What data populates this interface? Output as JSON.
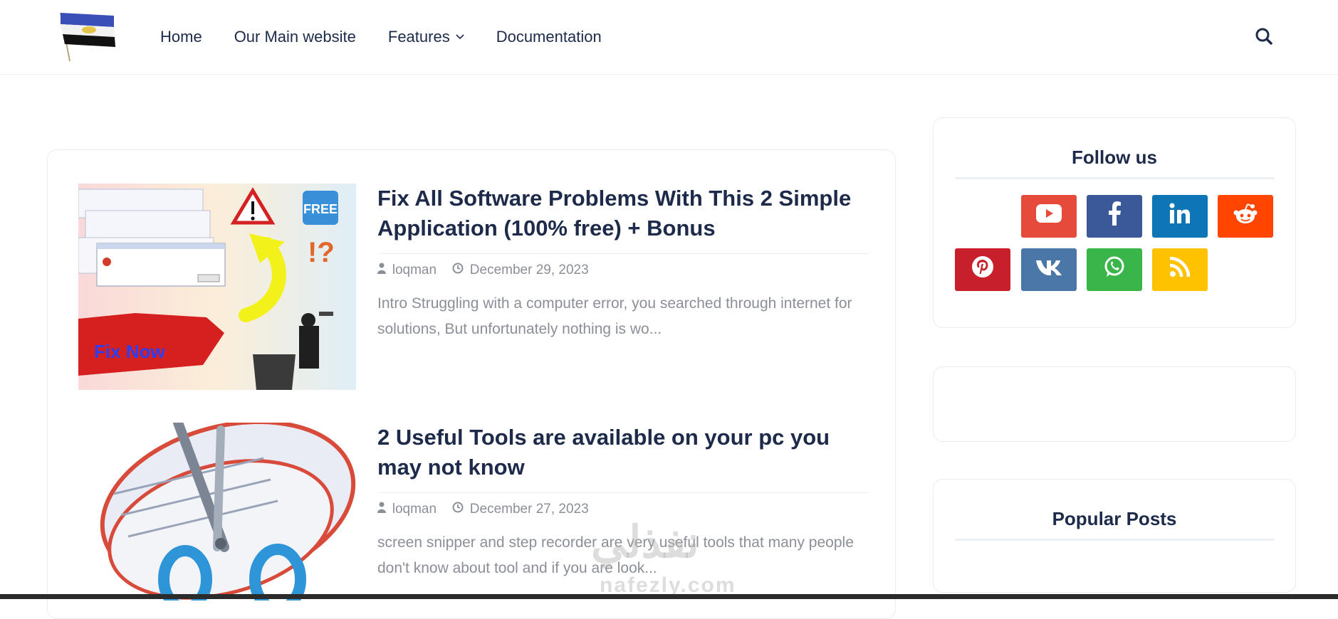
{
  "nav": {
    "items": [
      {
        "label": "Home"
      },
      {
        "label": "Our Main website"
      },
      {
        "label": "Features",
        "chevron": "⌄"
      },
      {
        "label": "Documentation"
      }
    ]
  },
  "posts": [
    {
      "title": "Fix All Software Problems With This 2 Simple Application (100% free) + Bonus",
      "author": "loqman",
      "date": "December 29, 2023",
      "snippet": "Intro  Struggling with a computer error, you searched through internet for solutions, But unfortunately nothing is wo...",
      "thumb_text": "Fix Now",
      "thumb_badge": "FREE"
    },
    {
      "title": "2 Useful Tools are available on your pc you may not know",
      "author": "loqman",
      "date": "December 27, 2023",
      "snippet": "screen snipper and step recorder are very useful tools that many people don't know about tool and if you are look..."
    }
  ],
  "sidebar": {
    "follow_title": "Follow us",
    "popular_title": "Popular Posts",
    "socials": [
      {
        "name": "youtube-icon",
        "glyph": "▶",
        "color": "#e54a3b"
      },
      {
        "name": "facebook-icon",
        "glyph": "f",
        "color": "#3b5998"
      },
      {
        "name": "linkedin-icon",
        "glyph": "in",
        "color": "#0e76b5"
      },
      {
        "name": "reddit-icon",
        "glyph": "☻",
        "color": "#ff4500"
      },
      {
        "name": "pinterest-icon",
        "glyph": "P",
        "color": "#c8202b"
      },
      {
        "name": "vk-icon",
        "glyph": "vk",
        "color": "#4a76a8"
      },
      {
        "name": "whatsapp-icon",
        "glyph": "✆",
        "color": "#3ab54a"
      },
      {
        "name": "rss-icon",
        "glyph": "◉",
        "color": "#ffc200"
      }
    ]
  },
  "watermark": {
    "arabic": "نفذلي",
    "latin": "nafezly.com"
  },
  "colors": {
    "heading": "#1d2a4a",
    "muted": "#8a8f98",
    "border": "#e8ebef"
  }
}
